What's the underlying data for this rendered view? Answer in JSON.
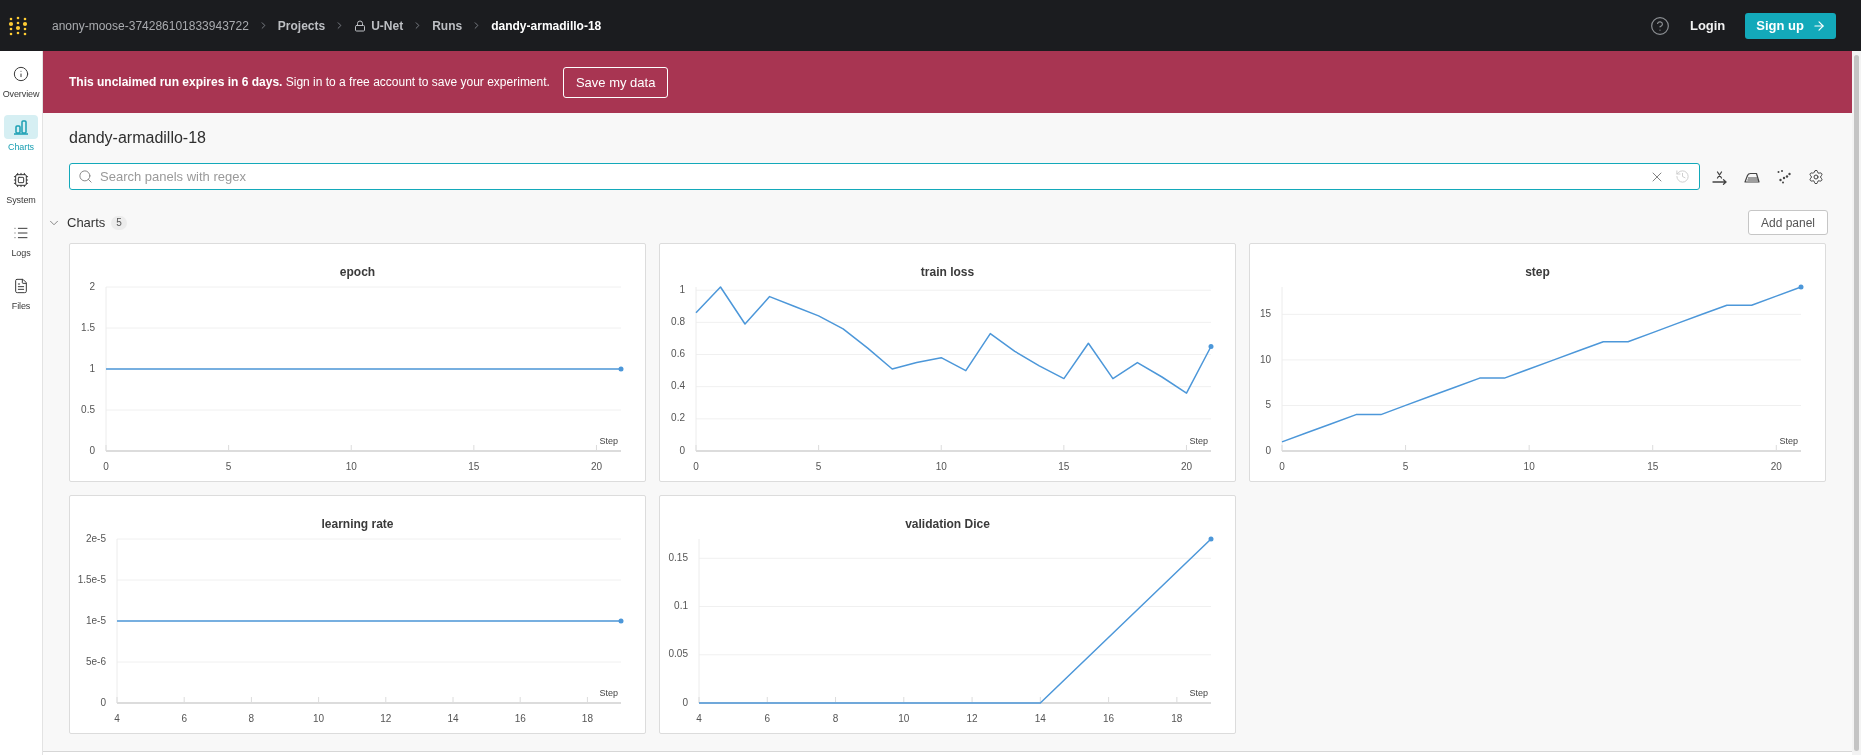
{
  "top_bar": {
    "breadcrumbs": [
      {
        "label": "anony-moose-374286101833943722",
        "kind": "owner"
      },
      {
        "label": "Projects",
        "kind": "plain"
      },
      {
        "label": "U-Net",
        "kind": "locked"
      },
      {
        "label": "Runs",
        "kind": "plain"
      },
      {
        "label": "dandy-armadillo-18",
        "kind": "current"
      }
    ],
    "login": "Login",
    "signup": "Sign up"
  },
  "sidebar": {
    "items": [
      {
        "label": "Overview",
        "kind": "overview",
        "selected": false
      },
      {
        "label": "Charts",
        "kind": "charts",
        "selected": true
      },
      {
        "label": "System",
        "kind": "system",
        "selected": false
      },
      {
        "label": "Logs",
        "kind": "logs",
        "selected": false
      },
      {
        "label": "Files",
        "kind": "files",
        "selected": false
      }
    ]
  },
  "banner": {
    "message": "**This unclaimed run expires in 6 days.** Sign in to a free account to save your experiment.",
    "button": "Save my data"
  },
  "run_title": "dandy-armadillo-18",
  "search": {
    "placeholder": "Search panels with regex"
  },
  "section": {
    "title": "Charts",
    "count": "5",
    "expanded": true,
    "add_button": "Add panel"
  },
  "panels": [
    {
      "chart_data": {
        "type": "line",
        "title": "epoch",
        "xlabel": "Step",
        "x": [
          0,
          21
        ],
        "series": [
          {
            "color": "#4c97d9",
            "values": [
              1,
              1
            ]
          }
        ],
        "xlim": [
          0,
          21
        ],
        "ylim": [
          0,
          2
        ],
        "xticks": [
          0,
          5,
          10,
          15,
          20
        ],
        "yticks": [
          0,
          0.5,
          1,
          1.5,
          2
        ],
        "grid": true
      }
    },
    {
      "chart_data": {
        "type": "line",
        "title": "train loss",
        "xlabel": "Step",
        "x": [
          0,
          1,
          2,
          3,
          4,
          5,
          6,
          7,
          8,
          9,
          10,
          11,
          12,
          13,
          14,
          15,
          16,
          17,
          18,
          19,
          20,
          21
        ],
        "series": [
          {
            "color": "#4c97d9",
            "values": [
              0.86,
              1.02,
              0.79,
              0.96,
              0.9,
              0.84,
              0.76,
              0.64,
              0.51,
              0.55,
              0.58,
              0.5,
              0.73,
              0.62,
              0.53,
              0.45,
              0.67,
              0.45,
              0.55,
              0.46,
              0.36,
              0.65
            ]
          }
        ],
        "xlim": [
          0,
          21
        ],
        "ylim": [
          0,
          1.02
        ],
        "xticks": [
          0,
          5,
          10,
          15,
          20
        ],
        "yticks": [
          0,
          0.2,
          0.4,
          0.6,
          0.8,
          1
        ],
        "grid": true
      }
    },
    {
      "chart_data": {
        "type": "line",
        "title": "step",
        "xlabel": "Step",
        "x": [
          0,
          1,
          2,
          3,
          4,
          5,
          6,
          7,
          8,
          9,
          10,
          11,
          12,
          13,
          14,
          15,
          16,
          17,
          18,
          19,
          20,
          21
        ],
        "series": [
          {
            "color": "#4c97d9",
            "values": [
              1,
              2,
              3,
              4,
              4,
              5,
              6,
              7,
              8,
              8,
              9,
              10,
              11,
              12,
              12,
              13,
              14,
              15,
              16,
              16,
              17,
              18
            ]
          }
        ],
        "xlim": [
          0,
          21
        ],
        "ylim": [
          0,
          18
        ],
        "xticks": [
          0,
          5,
          10,
          15,
          20
        ],
        "yticks": [
          0,
          5,
          10,
          15
        ],
        "grid": true
      }
    },
    {
      "chart_data": {
        "type": "line",
        "title": "learning rate",
        "xlabel": "Step",
        "x": [
          4,
          19
        ],
        "series": [
          {
            "color": "#4c97d9",
            "values": [
              1e-05,
              1e-05
            ]
          }
        ],
        "xlim": [
          4,
          19
        ],
        "ylim": [
          0,
          2e-05
        ],
        "xticks": [
          4,
          6,
          8,
          10,
          12,
          14,
          16,
          18
        ],
        "yticks": [
          {
            "value": 0,
            "label": "0"
          },
          {
            "value": 5e-06,
            "label": "5e-6"
          },
          {
            "value": 1e-05,
            "label": "1e-5"
          },
          {
            "value": 1.5e-05,
            "label": "1.5e-5"
          },
          {
            "value": 2e-05,
            "label": "2e-5"
          }
        ],
        "grid": true
      }
    },
    {
      "chart_data": {
        "type": "line",
        "title": "validation Dice",
        "xlabel": "Step",
        "x": [
          4,
          14,
          19
        ],
        "series": [
          {
            "color": "#4c97d9",
            "values": [
              0,
              0,
              0.17
            ]
          }
        ],
        "xlim": [
          4,
          19
        ],
        "ylim": [
          0,
          0.17
        ],
        "xticks": [
          4,
          6,
          8,
          10,
          12,
          14,
          16,
          18
        ],
        "yticks": [
          0,
          0.05,
          0.1,
          0.15
        ],
        "grid": true
      }
    }
  ]
}
